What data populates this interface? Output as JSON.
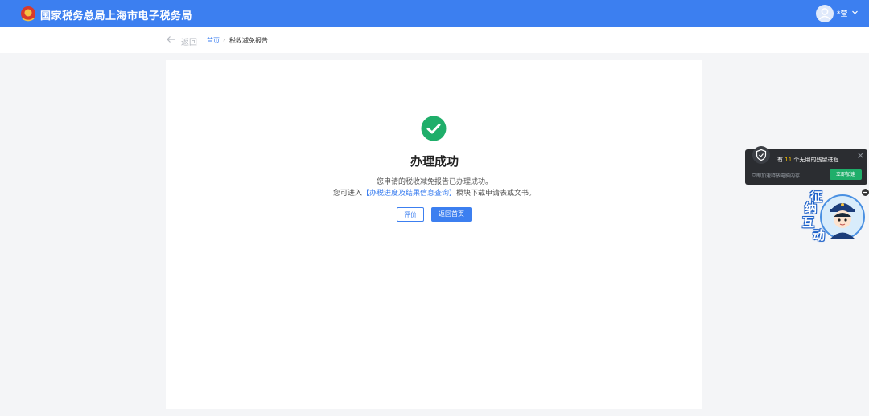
{
  "header": {
    "site_title": "国家税务总局上海市电子税务局",
    "user_name": "*莹",
    "brand_color": "#3c7ff0"
  },
  "breadcrumb": {
    "back_label": "返回",
    "home": "首页",
    "separator": "›",
    "current": "税收减免报告"
  },
  "result": {
    "title": "办理成功",
    "message_line1": "您申请的税收减免报告已办理成功。",
    "message_line2_prefix": "您可进入",
    "message_link": "【办税进度及结果信息查询】",
    "message_line2_suffix": "模块下载申请表或文书。",
    "rate_button": "评价",
    "home_button": "返回首页",
    "success_color": "#1fae6a"
  },
  "popup": {
    "line1_prefix": "有",
    "count": "11",
    "line1_suffix": "个无用的残留进程",
    "line2": "立即加速释放电脑内存",
    "action_button": "立即加速"
  },
  "mascot": {
    "chars": [
      "征",
      "纳",
      "互",
      "动"
    ]
  }
}
